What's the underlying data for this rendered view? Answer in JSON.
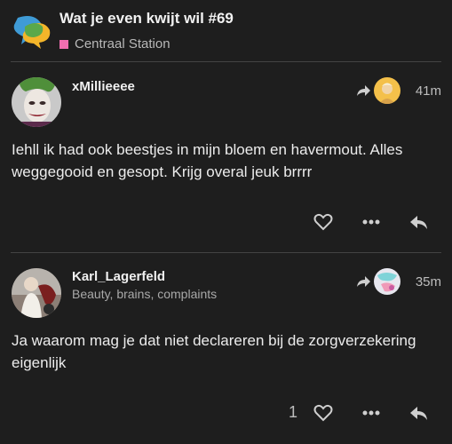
{
  "topic": {
    "title": "Wat je even kwijt wil #69",
    "category": "Centraal Station",
    "category_color": "#f06eb0"
  },
  "posts": [
    {
      "username": "xMillieeee",
      "user_title": "",
      "time": "41m",
      "text": "Iehll ik had ook beestjes in mijn bloem en havermout. Alles weggegooid en gesopt. Krijg overal jeuk brrrr",
      "likes": ""
    },
    {
      "username": "Karl_Lagerfeld",
      "user_title": "Beauty, brains, complaints",
      "time": "35m",
      "text": "Ja waarom mag je dat niet declareren bij de zorgverzekering eigenlijk",
      "likes": "1"
    }
  ],
  "icons": {
    "logo": "forum-logo-icon",
    "reply_to": "reply-to-arrow-icon",
    "like": "heart-icon",
    "more": "more-dots-icon",
    "reply": "reply-icon"
  }
}
